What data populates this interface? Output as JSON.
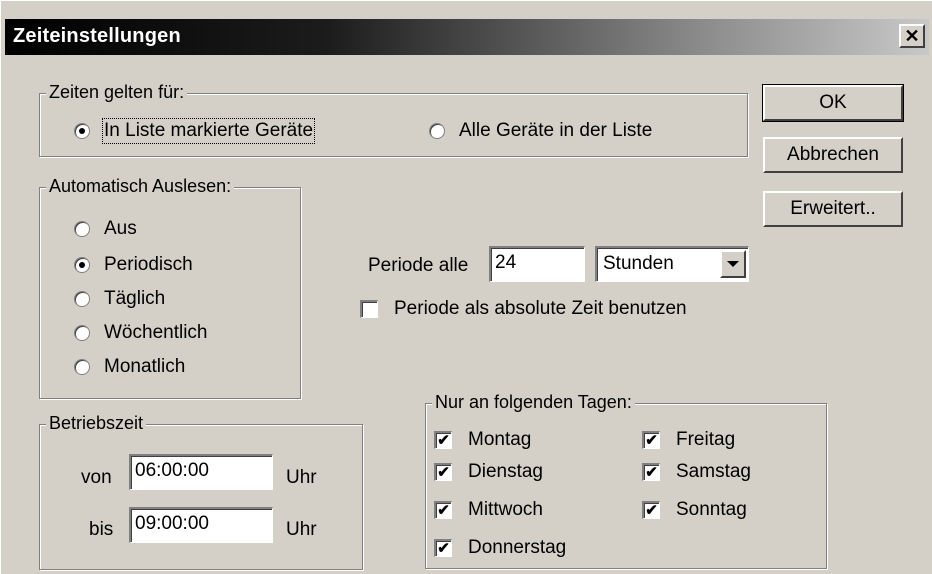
{
  "window": {
    "title": "Zeiteinstellungen",
    "close_glyph": "✕"
  },
  "apply_to": {
    "legend": "Zeiten gelten für:",
    "options": [
      {
        "label": "In Liste markierte Geräte",
        "selected": true
      },
      {
        "label": "Alle Geräte in der Liste",
        "selected": false
      }
    ]
  },
  "buttons": {
    "ok": "OK",
    "cancel": "Abbrechen",
    "extended": "Erweitert.."
  },
  "auto_read": {
    "legend": "Automatisch Auslesen:",
    "options": [
      {
        "label": "Aus",
        "selected": false
      },
      {
        "label": "Periodisch",
        "selected": true
      },
      {
        "label": "Täglich",
        "selected": false
      },
      {
        "label": "Wöchentlich",
        "selected": false
      },
      {
        "label": "Monatlich",
        "selected": false
      }
    ]
  },
  "period": {
    "label": "Periode alle",
    "value": "24",
    "unit": "Stunden",
    "absolute_label": "Periode als absolute Zeit benutzen",
    "absolute_checked": false
  },
  "operating_time": {
    "legend": "Betriebszeit",
    "from_label": "von",
    "from_value": "06:00:00",
    "to_label": "bis",
    "to_value": "09:00:00",
    "unit": "Uhr"
  },
  "days": {
    "legend": "Nur an folgenden Tagen:",
    "items": [
      {
        "label": "Montag",
        "checked": true
      },
      {
        "label": "Dienstag",
        "checked": true
      },
      {
        "label": "Mittwoch",
        "checked": true
      },
      {
        "label": "Donnerstag",
        "checked": true
      },
      {
        "label": "Freitag",
        "checked": true
      },
      {
        "label": "Samstag",
        "checked": true
      },
      {
        "label": "Sonntag",
        "checked": true
      }
    ]
  }
}
